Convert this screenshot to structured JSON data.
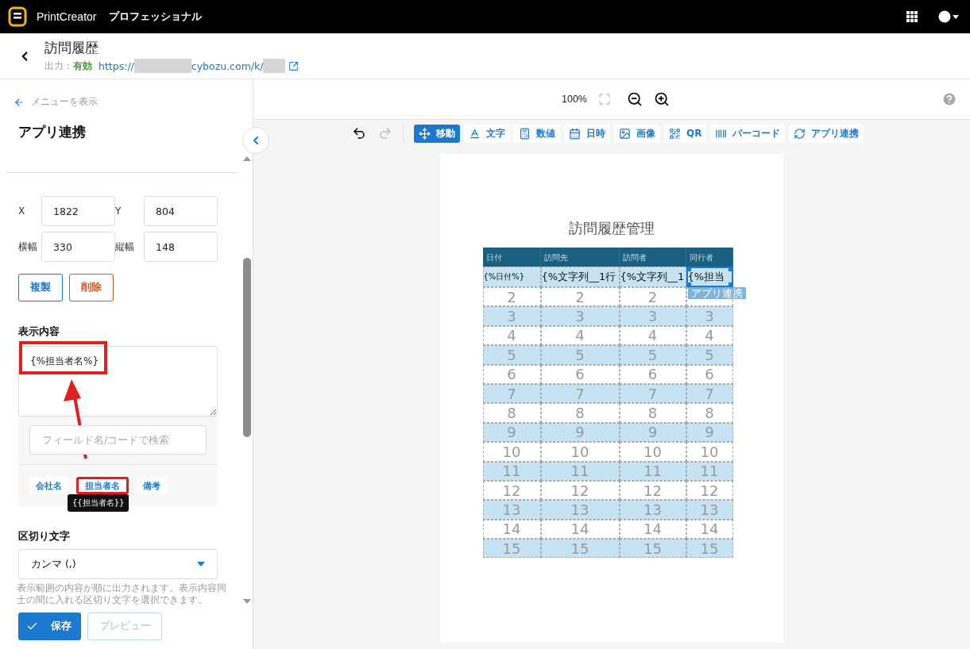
{
  "app": {
    "name": "PrintCreator",
    "edition": "プロフェッショナル"
  },
  "header": {
    "title": "訪問履歴",
    "output_label": "出力：",
    "output_status": "有効",
    "url_prefix": "https://",
    "url_middle": "cybozu.com/k/"
  },
  "sidebar": {
    "menu_link": "メニューを表示",
    "title": "アプリ連携",
    "fields": [
      {
        "label": "X",
        "value": "1822"
      },
      {
        "label": "Y",
        "value": "804"
      },
      {
        "label": "横幅",
        "value": "330"
      },
      {
        "label": "縦幅",
        "value": "148"
      }
    ],
    "actions": [
      {
        "label": "複製",
        "kind": "primary"
      },
      {
        "label": "削除",
        "kind": "danger"
      }
    ],
    "content_label": "表示内容",
    "content_value": "{%担当者名%}",
    "search_placeholder": "フィールド名/コードで検索",
    "chips": [
      {
        "label": "会社名",
        "highlighted": false
      },
      {
        "label": "担当者名",
        "highlighted": true
      },
      {
        "label": "備考",
        "highlighted": false
      }
    ],
    "tooltip": "{{担当者名}}",
    "separator_label": "区切り文字",
    "separator_value": "カンマ (,)",
    "help": "表示範囲の内容が順に出力されます。表示内容同士の間に入れる区切り文字を選択できます。",
    "save": "保存",
    "preview": {
      "label": "プレビュー",
      "disabled": true
    }
  },
  "canvas": {
    "zoom": "100%",
    "tools": [
      {
        "label": "移動",
        "selected": true
      },
      {
        "label": "文字",
        "selected": false
      },
      {
        "label": "数値",
        "selected": false
      },
      {
        "label": "日時",
        "selected": false
      },
      {
        "label": "画像",
        "selected": false
      },
      {
        "label": "QR",
        "selected": false
      },
      {
        "label": "バーコード",
        "selected": false
      },
      {
        "label": "アプリ連携",
        "selected": false
      }
    ],
    "document": {
      "title": "訪問履歴管理",
      "columns": [
        "日付",
        "訪問先",
        "訪問者",
        "同行者"
      ],
      "rows": [
        [
          {
            "text": "{%日付%}",
            "selected": false
          },
          {
            "text": "{%文字列__1行",
            "selected": false
          },
          {
            "text": "{%文字列__1",
            "selected": false
          },
          {
            "text": "{%担当",
            "selected": true
          }
        ],
        [
          {
            "text": "2",
            "selected": false
          },
          {
            "text": "2",
            "selected": false
          },
          {
            "text": "2",
            "selected": false
          },
          {
            "selected": false
          }
        ],
        [
          {
            "text": "3",
            "selected": false
          },
          {
            "text": "3",
            "selected": false
          },
          {
            "text": "3",
            "selected": false
          },
          {
            "text": "3",
            "selected": false
          }
        ],
        [
          {
            "text": "4",
            "selected": false
          },
          {
            "text": "4",
            "selected": false
          },
          {
            "text": "4",
            "selected": false
          },
          {
            "text": "4",
            "selected": false
          }
        ],
        [
          {
            "text": "5",
            "selected": false
          },
          {
            "text": "5",
            "selected": false
          },
          {
            "text": "5",
            "selected": false
          },
          {
            "text": "5",
            "selected": false
          }
        ],
        [
          {
            "text": "6",
            "selected": false
          },
          {
            "text": "6",
            "selected": false
          },
          {
            "text": "6",
            "selected": false
          },
          {
            "text": "6",
            "selected": false
          }
        ],
        [
          {
            "text": "7",
            "selected": false
          },
          {
            "text": "7",
            "selected": false
          },
          {
            "text": "7",
            "selected": false
          },
          {
            "text": "7",
            "selected": false
          }
        ],
        [
          {
            "text": "8",
            "selected": false
          },
          {
            "text": "8",
            "selected": false
          },
          {
            "text": "8",
            "selected": false
          },
          {
            "text": "8",
            "selected": false
          }
        ],
        [
          {
            "text": "9",
            "selected": false
          },
          {
            "text": "9",
            "selected": false
          },
          {
            "text": "9",
            "selected": false
          },
          {
            "text": "9",
            "selected": false
          }
        ],
        [
          {
            "text": "10",
            "selected": false
          },
          {
            "text": "10",
            "selected": false
          },
          {
            "text": "10",
            "selected": false
          },
          {
            "text": "10",
            "selected": false
          }
        ],
        [
          {
            "text": "11",
            "selected": false
          },
          {
            "text": "11",
            "selected": false
          },
          {
            "text": "11",
            "selected": false
          },
          {
            "text": "11",
            "selected": false
          }
        ],
        [
          {
            "text": "12",
            "selected": false
          },
          {
            "text": "12",
            "selected": false
          },
          {
            "text": "12",
            "selected": false
          },
          {
            "text": "12",
            "selected": false
          }
        ],
        [
          {
            "text": "13",
            "selected": false
          },
          {
            "text": "13",
            "selected": false
          },
          {
            "text": "13",
            "selected": false
          },
          {
            "text": "13",
            "selected": false
          }
        ],
        [
          {
            "text": "14",
            "selected": false
          },
          {
            "text": "14",
            "selected": false
          },
          {
            "text": "14",
            "selected": false
          },
          {
            "text": "14",
            "selected": false
          }
        ],
        [
          {
            "text": "15",
            "selected": false
          },
          {
            "text": "15",
            "selected": false
          },
          {
            "text": "15",
            "selected": false
          },
          {
            "text": "15",
            "selected": false
          }
        ]
      ],
      "selection_label": "アプリ連携"
    }
  }
}
